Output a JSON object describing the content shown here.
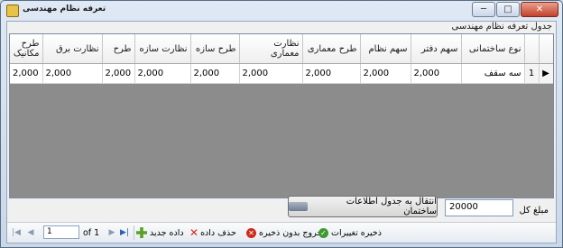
{
  "window": {
    "title": "تعرفه نظام مهندسی",
    "minimize": "─",
    "maximize": "□",
    "close": "✕"
  },
  "grid": {
    "caption": "جدول تعرفه نظام مهندسی",
    "columns": [
      "طرح مکانیک",
      "نظارت برق",
      "طرح",
      "نظارت سازه",
      "طرح سازه",
      "نظارت معماری",
      "طرح معماری",
      "سهم نظام",
      "سهم دفتر",
      "نوع ساختمانی"
    ],
    "rows": [
      {
        "values": [
          "2,000",
          "2,000",
          "2,000",
          "2,000",
          "2,000",
          "2,000",
          "2,000",
          "2,000",
          "2,000"
        ],
        "type": "سه سقف",
        "row_number": "1",
        "selector": "▶"
      }
    ]
  },
  "amount": {
    "label": "مبلغ کل",
    "value": "20000"
  },
  "transfer_button": "انتقال به جدول اطلاعات ساختمان",
  "navigator": {
    "position": "1",
    "of_text": "of 1",
    "first": "|◀",
    "prev": "◀",
    "next": "▶",
    "last": "▶|",
    "add_label": "داده جدید",
    "delete_label": "حذف داده",
    "exit_label": "خروج بدون ذخیره",
    "save_label": "ذخیره تغییرات"
  }
}
